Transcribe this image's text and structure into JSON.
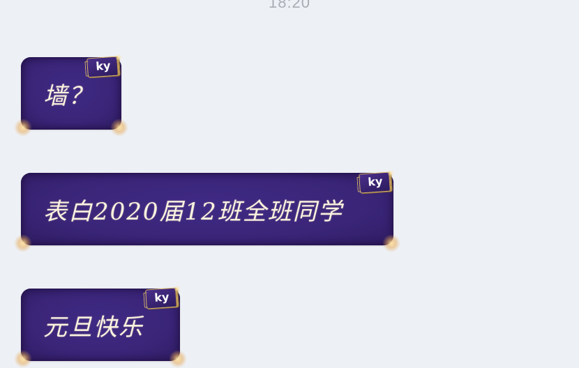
{
  "chat": {
    "timestamp": "18:20",
    "messages": [
      {
        "text": "墙？",
        "badge": "ky"
      },
      {
        "text": "表白2020届12班全班同学",
        "badge": "ky"
      },
      {
        "text": "元旦快乐",
        "badge": "ky"
      }
    ]
  },
  "theme": {
    "background": "#edf0f5",
    "bubble_color": "#3a2578",
    "bubble_text_color": "#fbf3df",
    "badge_border": "#d6b36a",
    "timestamp_color": "#a9adb3"
  }
}
